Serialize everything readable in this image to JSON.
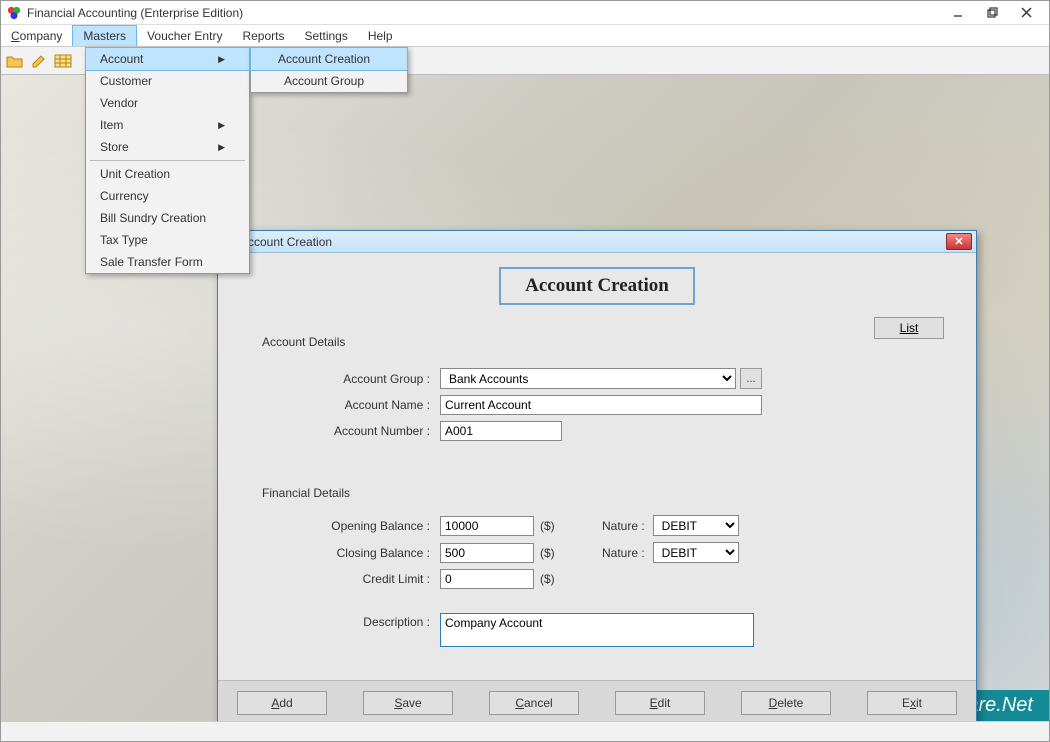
{
  "window": {
    "title": "Financial Accounting (Enterprise Edition)"
  },
  "menubar": {
    "company": "Company",
    "masters": "Masters",
    "voucher": "Voucher Entry",
    "reports": "Reports",
    "settings": "Settings",
    "help": "Help"
  },
  "masters_menu": {
    "account": "Account",
    "customer": "Customer",
    "vendor": "Vendor",
    "item": "Item",
    "store": "Store",
    "unit_creation": "Unit Creation",
    "currency": "Currency",
    "bill_sundry": "Bill Sundry Creation",
    "tax_type": "Tax Type",
    "sale_transfer": "Sale Transfer Form"
  },
  "account_submenu": {
    "creation": "Account Creation",
    "group": "Account Group"
  },
  "dialog": {
    "title": "Account Creation",
    "heading": "Account Creation",
    "list_btn": "List",
    "section_account": "Account Details",
    "section_financial": "Financial Details",
    "labels": {
      "account_group": "Account Group :",
      "account_name": "Account Name :",
      "account_number": "Account Number :",
      "opening_balance": "Opening Balance :",
      "closing_balance": "Closing Balance :",
      "credit_limit": "Credit Limit :",
      "nature": "Nature :",
      "description": "Description :",
      "currency": "($)"
    },
    "values": {
      "account_group": "Bank Accounts",
      "account_name": "Current Account",
      "account_number": "A001",
      "opening_balance": "10000",
      "closing_balance": "500",
      "credit_limit": "0",
      "nature1": "DEBIT",
      "nature2": "DEBIT",
      "description": "Company Account"
    },
    "buttons": {
      "add": "Add",
      "save": "Save",
      "cancel": "Cancel",
      "edit": "Edit",
      "delete": "Delete",
      "exit": "Exit"
    }
  },
  "watermark": "BarcodeLabelSoftware.Net"
}
